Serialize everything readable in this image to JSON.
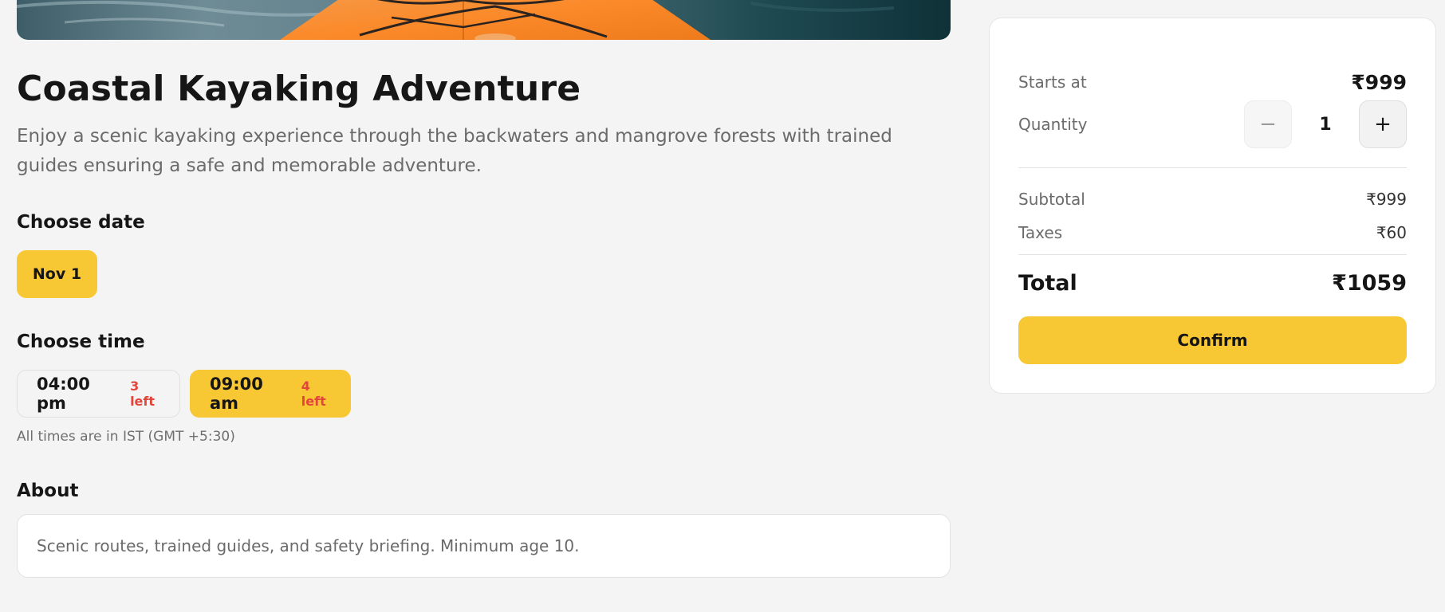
{
  "activity": {
    "title": "Coastal Kayaking Adventure",
    "description": "Enjoy a scenic kayaking experience through the backwaters and mangrove forests with trained guides ensuring a safe and memorable adventure."
  },
  "date_section": {
    "label": "Choose date",
    "options": [
      {
        "label": "Nov 1",
        "selected": true
      }
    ]
  },
  "time_section": {
    "label": "Choose time",
    "options": [
      {
        "time": "04:00 pm",
        "availability": "3 left",
        "selected": false
      },
      {
        "time": "09:00 am",
        "availability": "4 left",
        "selected": true
      }
    ],
    "timezone_note": "All times are in IST (GMT +5:30)"
  },
  "about": {
    "label": "About",
    "text": "Scenic routes, trained guides, and safety briefing. Minimum age 10."
  },
  "booking": {
    "starts_at_label": "Starts at",
    "starts_at_value": "₹999",
    "quantity_label": "Quantity",
    "quantity_value": "1",
    "minus_symbol": "−",
    "plus_symbol": "+",
    "subtotal_label": "Subtotal",
    "subtotal_value": "₹999",
    "taxes_label": "Taxes",
    "taxes_value": "₹60",
    "total_label": "Total",
    "total_value": "₹1059",
    "confirm_label": "Confirm"
  },
  "colors": {
    "accent": "#f8c734",
    "availability": "#e2463b",
    "background": "#f4f4f4"
  },
  "icons": {
    "decrement": "minus-icon",
    "increment": "plus-icon"
  }
}
